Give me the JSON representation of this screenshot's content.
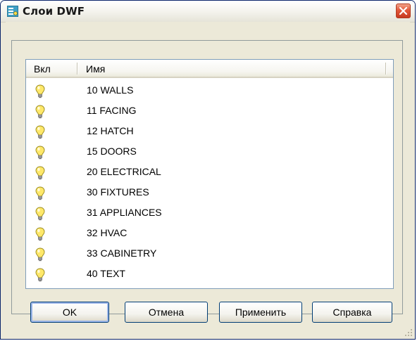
{
  "window": {
    "title": "Слои DWF",
    "app_icon": "layers-dwf-icon",
    "close_icon": "close-icon"
  },
  "list": {
    "columns": [
      {
        "label": "Вкл"
      },
      {
        "label": "Имя"
      }
    ],
    "rows": [
      {
        "on": true,
        "name": "10 WALLS"
      },
      {
        "on": true,
        "name": "11 FACING"
      },
      {
        "on": true,
        "name": "12 HATCH"
      },
      {
        "on": true,
        "name": "15 DOORS"
      },
      {
        "on": true,
        "name": "20 ELECTRICAL"
      },
      {
        "on": true,
        "name": "30 FIXTURES"
      },
      {
        "on": true,
        "name": "31 APPLIANCES"
      },
      {
        "on": true,
        "name": "32 HVAC"
      },
      {
        "on": true,
        "name": "33 CABINETRY"
      },
      {
        "on": true,
        "name": "40 TEXT"
      }
    ]
  },
  "buttons": {
    "ok": "OK",
    "cancel": "Отмена",
    "apply": "Применить",
    "help": "Справка"
  },
  "colors": {
    "title_bar": "#f3f2ec",
    "dialog_bg": "#ece9d8",
    "close_button": "#e2583a",
    "bulb_on": "#ffe86a",
    "list_border": "#7f9db9"
  }
}
